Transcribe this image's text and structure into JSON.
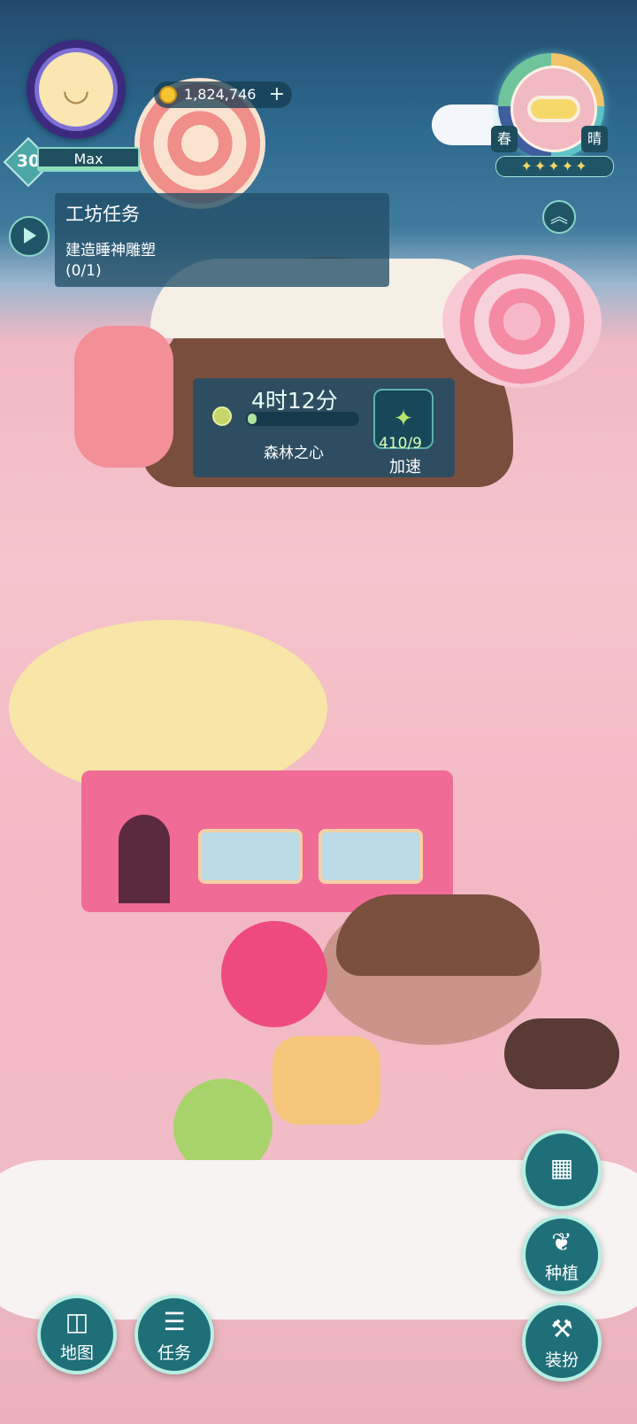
{
  "player": {
    "level": "30",
    "level_label": "Max",
    "level_progress": 1.0
  },
  "currency": {
    "coins": "1,824,746",
    "plus": "+"
  },
  "season": {
    "season_label": "春",
    "weather_label": "晴",
    "stars": "✦✦✦✦✦",
    "collapse": "︽"
  },
  "task": {
    "title": "工坊任务",
    "description": "建造睡神雕塑",
    "progress": "(0/1)"
  },
  "build_timer": {
    "time": "4时12分",
    "progress": 0.08,
    "item_name": "森林之心",
    "speedup_count": "410/9",
    "speedup_label": "加速"
  },
  "buttons": {
    "grid": "",
    "plant": "种植",
    "dress": "装扮",
    "map": "地图",
    "task": "任务"
  },
  "icons": {
    "plant": "sprout-icon",
    "dress": "hammer-icon",
    "map": "map-icon",
    "task": "clipboard-icon",
    "grid": "grid-icon"
  }
}
